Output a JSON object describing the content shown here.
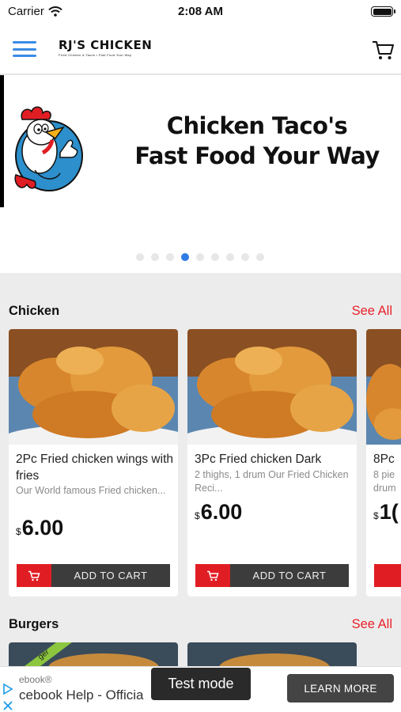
{
  "status_bar": {
    "carrier": "Carrier",
    "time": "2:08 AM"
  },
  "header": {
    "brand": "RJ'S CHICKEN",
    "tagline": "Fried Chicken & Tacos • Fast Food Your Way"
  },
  "hero": {
    "line1": "Chicken Taco's",
    "line2": "Fast Food Your Way",
    "carousel": {
      "total": 9,
      "active_index": 3
    }
  },
  "colors": {
    "accent": "#e8202a",
    "link_blue": "#2f7de3",
    "button_dark": "#3c3c3c"
  },
  "sections": [
    {
      "title": "Chicken",
      "see_all": "See All",
      "products": [
        {
          "name": "2Pc Fried chicken wings with fries",
          "description": "Our World famous Fried chicken...",
          "currency": "$",
          "price": "6.00",
          "button": "ADD TO CART"
        },
        {
          "name": "3Pc Fried chicken Dark",
          "description": "2 thighs, 1 drum Our Fried Chicken Reci...",
          "currency": "$",
          "price": "6.00",
          "button": "ADD TO CART"
        },
        {
          "name": "8Pc",
          "description": "8 pie drum",
          "currency": "$",
          "price": "1("
        }
      ]
    },
    {
      "title": "Burgers",
      "see_all": "See All",
      "ribbon": "ger"
    }
  ],
  "ad": {
    "brand": "ebook®",
    "headline": "cebook Help - Officia",
    "test_mode": "Test mode",
    "cta": "LEARN MORE"
  }
}
